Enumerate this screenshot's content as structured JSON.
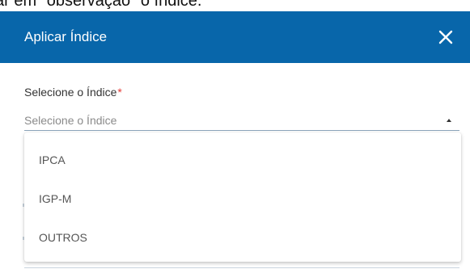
{
  "background_instruction_text": "ar em \"observação\" o índice.",
  "modal": {
    "title": "Aplicar Índice",
    "close_icon": "close-icon",
    "header_color": "#0866aa"
  },
  "index_field": {
    "label": "Selecione o Índice",
    "required_marker": "*",
    "placeholder": "Selecione o Índice",
    "caret_icon": "caret-up-icon",
    "options": [
      "IPCA",
      "IGP-M",
      "OUTROS"
    ]
  }
}
